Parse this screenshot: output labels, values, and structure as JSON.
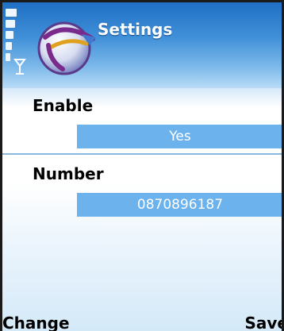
{
  "titlebar": {
    "title": "Settings"
  },
  "fields": [
    {
      "label": "Enable",
      "value": "Yes"
    },
    {
      "label": "Number",
      "value": "0870896187"
    }
  ],
  "softkeys": {
    "left": "Change",
    "right": "Save"
  },
  "colors": {
    "title_bar": "#3f8fd8",
    "value_highlight": "#6cb2ec",
    "divider": "#8ab8de"
  },
  "icons": [
    "signal-strength-icon",
    "app-logo-icon",
    "antenna-icon"
  ]
}
